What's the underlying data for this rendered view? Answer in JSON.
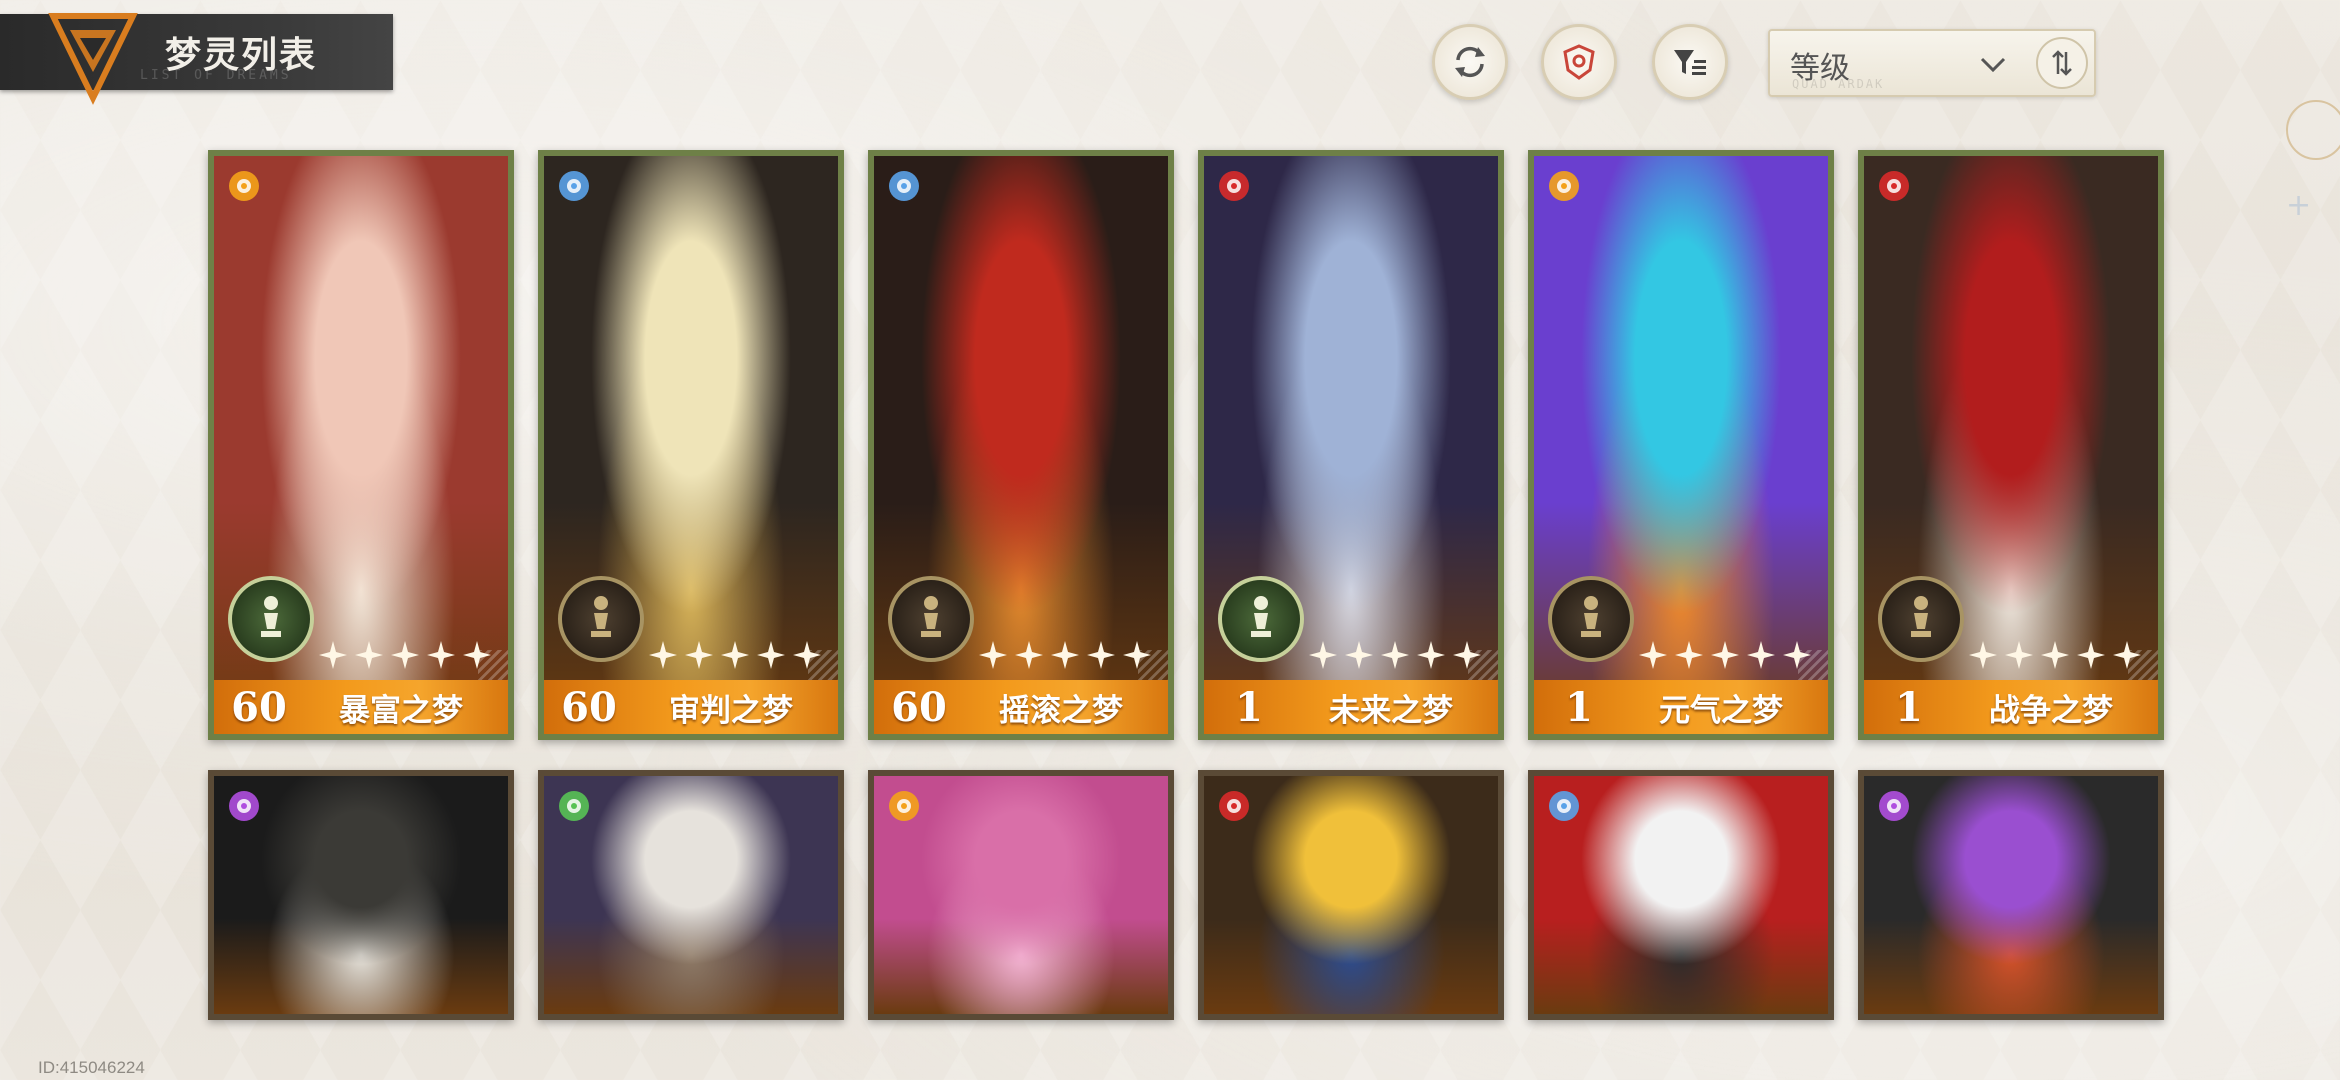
{
  "header": {
    "title": "梦灵列表",
    "subtitle": "LIST OF DREAMS",
    "icon": "triangle-logo-icon"
  },
  "toolbar": {
    "refresh_icon": "refresh-icon",
    "filter_element_icon": "shield-filter-icon",
    "filter_icon": "filter-list-icon",
    "sort_label": "等级",
    "sort_sublabel": "QUAD ARDAK",
    "sort_dropdown_icon": "chevron-down-icon",
    "sort_order_icon": "sort-order-icon"
  },
  "cards": [
    {
      "level": "60",
      "name": "暴富之梦",
      "element": "gold",
      "rank": "green",
      "stars": 5,
      "art": [
        "#f0c7b7",
        "#9b3a2f",
        "#f2e7d9"
      ]
    },
    {
      "level": "60",
      "name": "审判之梦",
      "element": "blue",
      "rank": "bronze",
      "stars": 5,
      "art": [
        "#efe4b8",
        "#2d2620",
        "#d9b55a"
      ]
    },
    {
      "level": "60",
      "name": "摇滚之梦",
      "element": "blue",
      "rank": "bronze",
      "stars": 5,
      "art": [
        "#c02a1e",
        "#2a1d18",
        "#e3892d"
      ]
    },
    {
      "level": "1",
      "name": "未来之梦",
      "element": "red",
      "rank": "green",
      "stars": 5,
      "art": [
        "#9fb2d6",
        "#2e2848",
        "#d9d9e2"
      ]
    },
    {
      "level": "1",
      "name": "元气之梦",
      "element": "gold",
      "rank": "bronze",
      "stars": 5,
      "art": [
        "#33c7e3",
        "#6a3fcf",
        "#ef8a2a"
      ]
    },
    {
      "level": "1",
      "name": "战争之梦",
      "element": "red",
      "rank": "bronze",
      "stars": 5,
      "art": [
        "#b21d1d",
        "#3a2a22",
        "#f0e8df"
      ]
    }
  ],
  "cards_row2": [
    {
      "element": "purple",
      "art": [
        "#3b3a36",
        "#1b1b1b",
        "#e8e4dc"
      ]
    },
    {
      "element": "green",
      "art": [
        "#e6e2dc",
        "#3d3553",
        "#8f7b67"
      ]
    },
    {
      "element": "gold",
      "art": [
        "#d96fa8",
        "#c24d8f",
        "#f4b6d4"
      ]
    },
    {
      "element": "red",
      "art": [
        "#f0c03a",
        "#3c2b1a",
        "#2d4c8f"
      ]
    },
    {
      "element": "blue",
      "art": [
        "#f2f2f2",
        "#b81f1f",
        "#2b2b2b"
      ]
    },
    {
      "element": "purple",
      "art": [
        "#9a4fd0",
        "#2a2a2a",
        "#d5522a"
      ]
    }
  ],
  "footer": {
    "user_id": "ID:415046224"
  },
  "colors": {
    "card_border": "#6e8047",
    "footer_orange": "#f39a1c",
    "element_gold": "#f4a21a",
    "element_blue": "#5aa2e8",
    "element_red": "#d82a2a",
    "element_purple": "#b04fe0",
    "element_green": "#58c255"
  }
}
